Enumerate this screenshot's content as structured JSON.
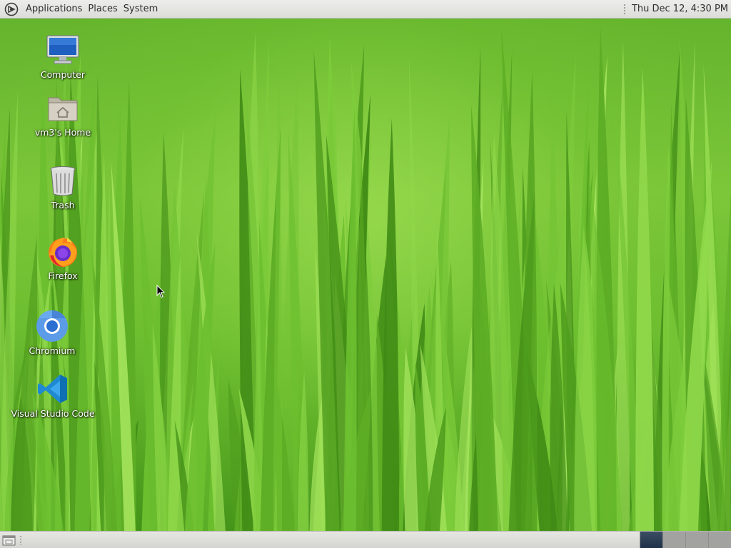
{
  "top_panel": {
    "menus": [
      "Applications",
      "Places",
      "System"
    ],
    "clock": "Thu Dec 12,  4:30 PM"
  },
  "desktop": {
    "icons": [
      {
        "label": "Computer",
        "icon": "computer-icon"
      },
      {
        "label": "vm3's Home",
        "icon": "home-folder-icon"
      },
      {
        "label": "Trash",
        "icon": "trash-icon"
      },
      {
        "label": "Firefox",
        "icon": "firefox-icon"
      },
      {
        "label": "Chromium",
        "icon": "chromium-icon"
      },
      {
        "label": "Visual Studio Code",
        "icon": "vscode-icon"
      }
    ]
  },
  "bottom_panel": {
    "workspaces": [
      "1",
      "2",
      "3",
      "4"
    ],
    "active_workspace": "1"
  },
  "colors": {
    "panel": "#dcdcd8",
    "active_workspace": "#1f3148",
    "wallpaper_green": "#6cbd30"
  }
}
